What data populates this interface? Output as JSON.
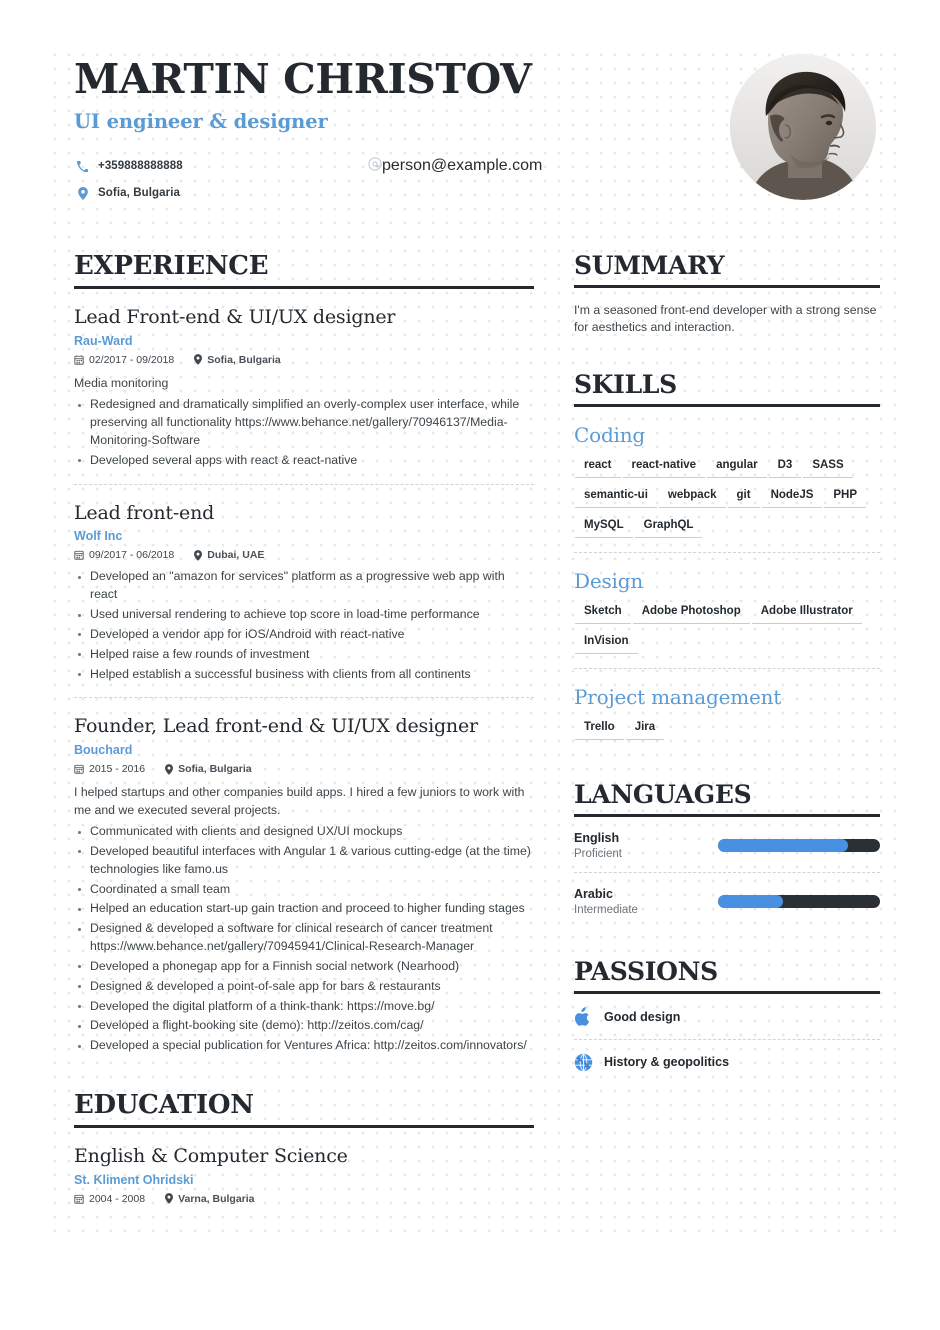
{
  "header": {
    "name": "MARTIN CHRISTOV",
    "title": "UI engineer & designer",
    "phone": "+359888888888",
    "email": "person@example.com",
    "location": "Sofia, Bulgaria"
  },
  "accent_color": "#5b9bd5",
  "sections": {
    "experience_heading": "EXPERIENCE",
    "education_heading": "EDUCATION",
    "summary_heading": "SUMMARY",
    "skills_heading": "SKILLS",
    "languages_heading": "LANGUAGES",
    "passions_heading": "PASSIONS"
  },
  "summary": {
    "text": "I'm a seasoned front-end developer with a strong sense for aesthetics and interaction."
  },
  "experience": [
    {
      "title": "Lead Front-end & UI/UX designer",
      "org": "Rau-Ward",
      "date": "02/2017 - 09/2018",
      "place": "Sofia, Bulgaria",
      "desc": "Media monitoring",
      "bullets": [
        "Redesigned and dramatically simplified an overly-complex user interface, while preserving all functionality https://www.behance.net/gallery/70946137/Media-Monitoring-Software",
        "Developed several apps with react & react-native"
      ]
    },
    {
      "title": "Lead front-end",
      "org": "Wolf Inc",
      "date": "09/2017 - 06/2018",
      "place": "Dubai, UAE",
      "desc": "",
      "bullets": [
        "Developed an \"amazon for services\" platform as a progressive web app with react",
        "Used universal rendering to achieve top score in load-time performance",
        "Developed a vendor app for iOS/Android with react-native",
        "Helped raise a few rounds of investment",
        "Helped establish a successful business with clients from all continents"
      ]
    },
    {
      "title": "Founder, Lead front-end & UI/UX designer",
      "org": "Bouchard",
      "date": "2015 - 2016",
      "place": "Sofia, Bulgaria",
      "desc": "I helped startups and other companies build apps. I hired a few juniors to work with me and we executed several projects.",
      "bullets": [
        "Communicated with clients and designed UX/UI mockups",
        "Developed beautiful interfaces with Angular 1 & various cutting-edge (at the time) technologies like famo.us",
        "Coordinated a small team",
        "Helped an education start-up gain traction and proceed to higher funding stages",
        "Designed & developed a software for clinical research of cancer treatment https://www.behance.net/gallery/70945941/Clinical-Research-Manager",
        "Developed a phonegap app for a Finnish social network (Nearhood)",
        "Designed & developed a point-of-sale app for bars & restaurants",
        "Developed the digital platform of a think-thank: https://move.bg/",
        "Developed a flight-booking site (demo): http://zeitos.com/cag/",
        "Developed a special publication for Ventures Africa: http://zeitos.com/innovators/"
      ]
    }
  ],
  "education": [
    {
      "title": "English & Computer Science",
      "org": "St. Kliment Ohridski",
      "date": "2004 - 2008",
      "place": "Varna, Bulgaria"
    }
  ],
  "skills": [
    {
      "group": "Coding",
      "tags": [
        "react",
        "react-native",
        "angular",
        "D3",
        "SASS",
        "semantic-ui",
        "webpack",
        "git",
        "NodeJS",
        "PHP",
        "MySQL",
        "GraphQL"
      ]
    },
    {
      "group": "Design",
      "tags": [
        "Sketch",
        "Adobe Photoshop",
        "Adobe Illustrator",
        "InVision"
      ]
    },
    {
      "group": "Project management",
      "tags": [
        "Trello",
        "Jira"
      ]
    }
  ],
  "languages": [
    {
      "name": "English",
      "level": "Proficient",
      "percent": 80
    },
    {
      "name": "Arabic",
      "level": "Intermediate",
      "percent": 40
    }
  ],
  "passions": [
    {
      "label": "Good design",
      "icon": "apple-icon"
    },
    {
      "label": "History & geopolitics",
      "icon": "globe-icon"
    }
  ]
}
